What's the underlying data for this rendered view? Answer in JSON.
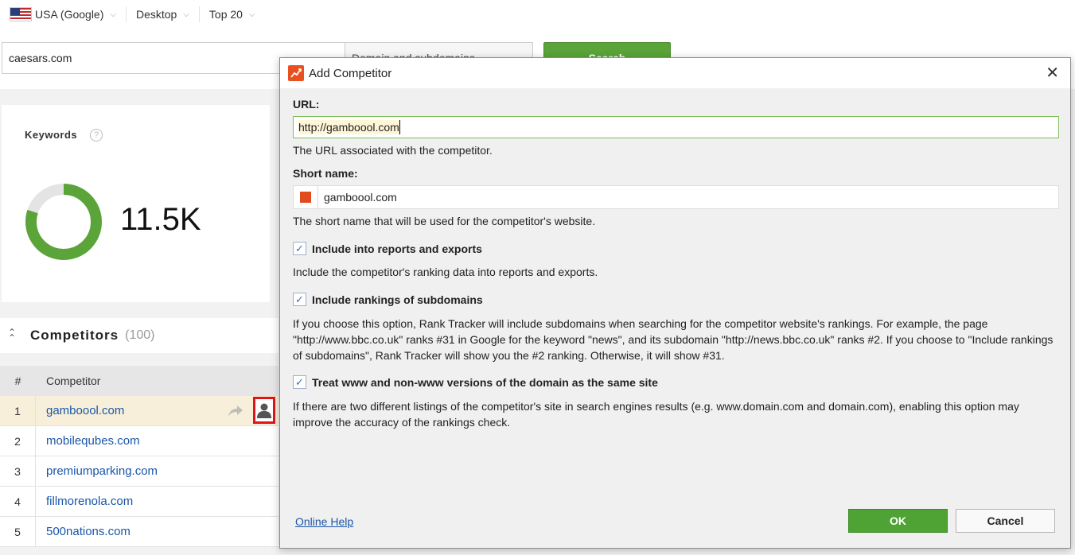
{
  "topbar": {
    "country": "USA (Google)",
    "device": "Desktop",
    "depth": "Top 20"
  },
  "search": {
    "value": "caesars.com",
    "scope": "Domain and subdomains",
    "button": "Search"
  },
  "keywords": {
    "title": "Keywords",
    "value": "11.5K",
    "donut_fraction": 0.8,
    "accent": "#5aa43a"
  },
  "competitors": {
    "title": "Competitors",
    "count": "(100)",
    "columns": {
      "num": "#",
      "name": "Competitor"
    },
    "rows": [
      {
        "num": "1",
        "name": "gamboool.com"
      },
      {
        "num": "2",
        "name": "mobilequbes.com"
      },
      {
        "num": "3",
        "name": "premiumparking.com"
      },
      {
        "num": "4",
        "name": "fillmorenola.com"
      },
      {
        "num": "5",
        "name": "500nations.com"
      }
    ]
  },
  "dialog": {
    "title": "Add Competitor",
    "url_label": "URL:",
    "url_value": "http://gamboool.com",
    "url_hint": "The URL associated with the competitor.",
    "name_label": "Short name:",
    "name_value": "gamboool.com",
    "name_hint": "The short name that will be used for the competitor's website.",
    "option1_label": "Include into reports and exports",
    "option1_hint": "Include the competitor's ranking data into reports and exports.",
    "option2_label": "Include rankings of subdomains",
    "option2_hint": "If you choose this option, Rank Tracker will include subdomains when searching for the competitor website's rankings. For example, the page \"http://www.bbc.co.uk\" ranks #31 in Google for the keyword \"news\", and its subdomain \"http://news.bbc.co.uk\" ranks #2. If you choose to \"Include rankings of subdomains\", Rank Tracker will show you the #2 ranking. Otherwise, it will show #31.",
    "option3_label": "Treat www and non-www versions of the domain as the same site",
    "option3_hint": "If there are two different listings of the competitor's site in search engines results (e.g. www.domain.com and domain.com), enabling this option may improve the accuracy of the rankings check.",
    "help_link": "Online Help",
    "ok": "OK",
    "cancel": "Cancel",
    "swatch_color": "#e04a1c"
  }
}
